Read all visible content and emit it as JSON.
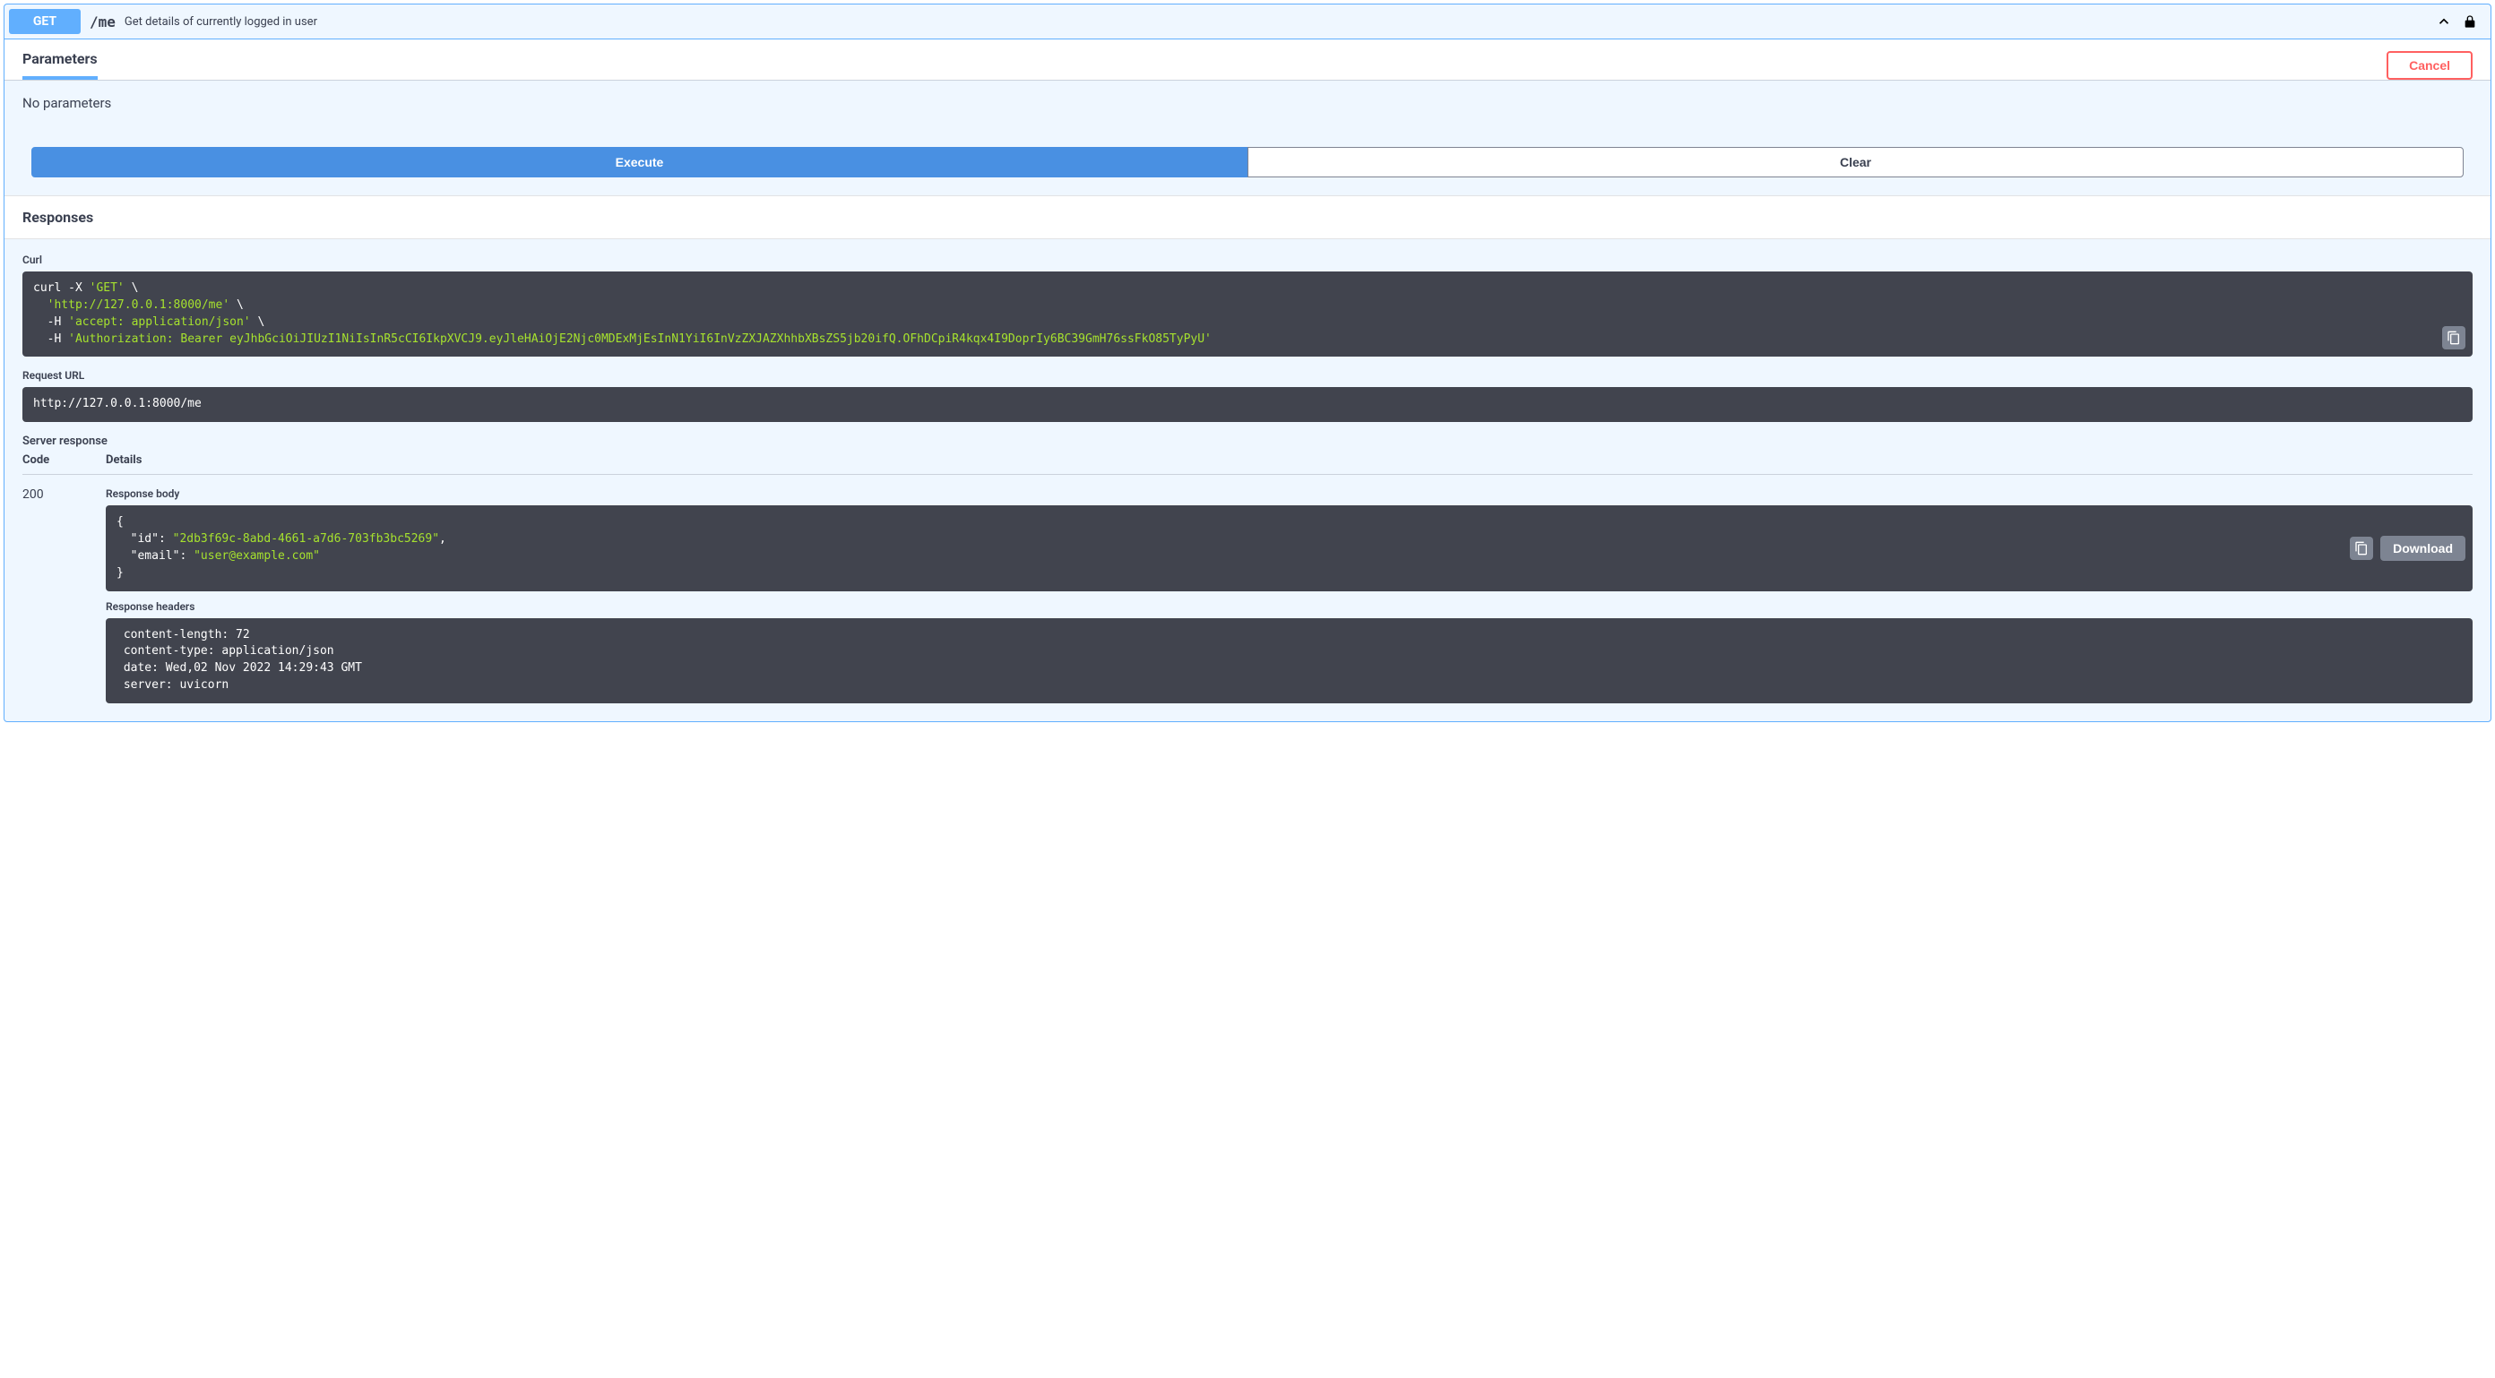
{
  "endpoint": {
    "method": "GET",
    "path": "/me",
    "description": "Get details of currently logged in user"
  },
  "sections": {
    "parameters_title": "Parameters",
    "cancel_label": "Cancel",
    "no_parameters": "No parameters",
    "execute_label": "Execute",
    "clear_label": "Clear",
    "responses_title": "Responses"
  },
  "curl": {
    "label": "Curl",
    "line1a": "curl -X ",
    "line1b": "'GET'",
    "line1c": " \\",
    "line2a": "  ",
    "line2b": "'http://127.0.0.1:8000/me'",
    "line2c": " \\",
    "line3a": "  -H ",
    "line3b": "'accept: application/json'",
    "line3c": " \\",
    "line4a": "  -H ",
    "line4b": "'Authorization: Bearer eyJhbGciOiJIUzI1NiIsInR5cCI6IkpXVCJ9.eyJleHAiOjE2Njc0MDExMjEsInN1YiI6InVzZXJAZXhhbXBsZS5jb20ifQ.OFhDCpiR4kqx4I9DoprIy6BC39GmH76ssFkO85TyPyU'"
  },
  "request_url": {
    "label": "Request URL",
    "value": "http://127.0.0.1:8000/me"
  },
  "server_response": {
    "label": "Server response",
    "code_header": "Code",
    "details_header": "Details",
    "status_code": "200",
    "body_label": "Response body",
    "body_open": "{",
    "body_id_key": "  \"id\"",
    "body_id_sep": ": ",
    "body_id_val": "\"2db3f69c-8abd-4661-a7d6-703fb3bc5269\"",
    "body_id_comma": ",",
    "body_email_key": "  \"email\"",
    "body_email_sep": ": ",
    "body_email_val": "\"user@example.com\"",
    "body_close": "}",
    "download_label": "Download",
    "headers_label": "Response headers",
    "headers_text": " content-length: 72 \n content-type: application/json \n date: Wed,02 Nov 2022 14:29:43 GMT \n server: uvicorn "
  }
}
